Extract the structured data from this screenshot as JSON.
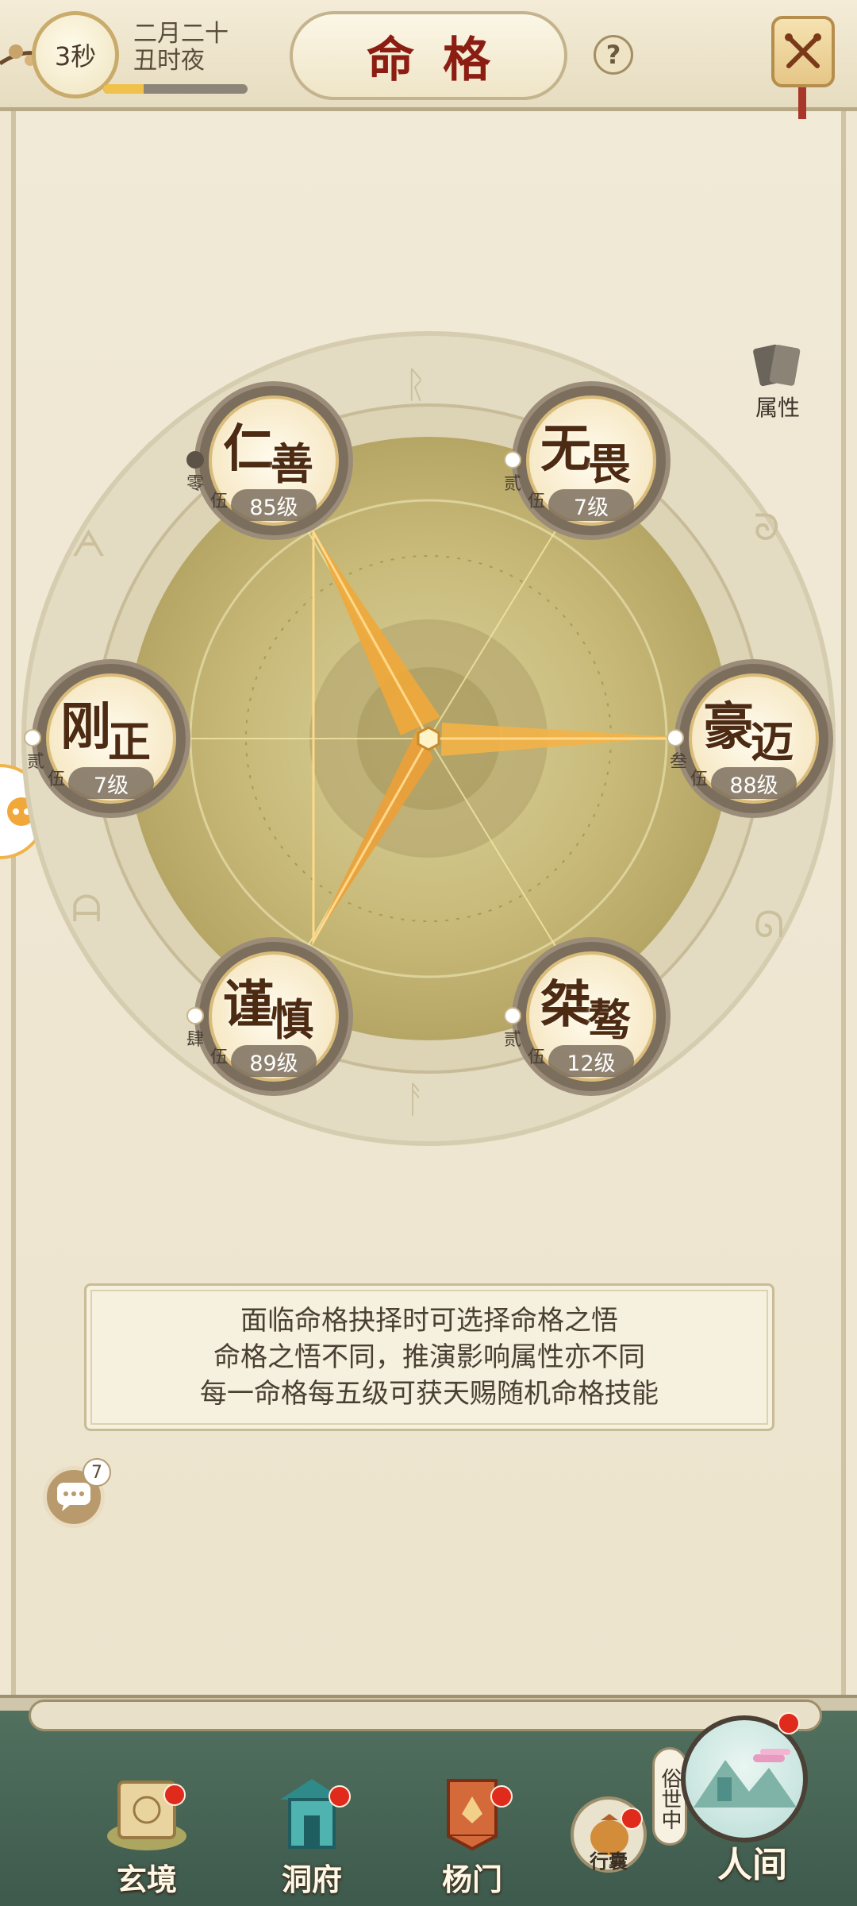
{
  "header": {
    "timer": "3秒",
    "date_line1": "二月二十",
    "date_line2": "丑时夜",
    "date_progress": 0.28,
    "title": "命格",
    "help": "?"
  },
  "attributes_button": {
    "label": "属性"
  },
  "nodes": [
    {
      "c1": "仁",
      "c2": "善",
      "level": "85级",
      "tier_a": "零",
      "tier_b": "伍"
    },
    {
      "c1": "无",
      "c2": "畏",
      "level": "7级",
      "tier_a": "贰",
      "tier_b": "伍"
    },
    {
      "c1": "刚",
      "c2": "正",
      "level": "7级",
      "tier_a": "贰",
      "tier_b": "伍"
    },
    {
      "c1": "豪",
      "c2": "迈",
      "level": "88级",
      "tier_a": "叁",
      "tier_b": "伍"
    },
    {
      "c1": "谨",
      "c2": "慎",
      "level": "89级",
      "tier_a": "肆",
      "tier_b": "伍"
    },
    {
      "c1": "桀",
      "c2": "骜",
      "level": "12级",
      "tier_a": "贰",
      "tier_b": "伍"
    }
  ],
  "info": {
    "line1": "面临命格抉择时可选择命格之悟",
    "line2": "命格之悟不同，推演影响属性亦不同",
    "line3": "每一命格每五级可获天赐随机命格技能"
  },
  "chat": {
    "badge": "7"
  },
  "nav": {
    "xuanjing": "玄境",
    "dongfu": "洞府",
    "yangmen": "杨门",
    "xingnang": "行囊",
    "sushizhong": "俗世中",
    "renjian": "人间"
  },
  "colors": {
    "title_red": "#8b1d12",
    "accent_gold": "#f0a83a",
    "bar_green": "#4a6a58",
    "badge_red": "#e02a1c"
  }
}
